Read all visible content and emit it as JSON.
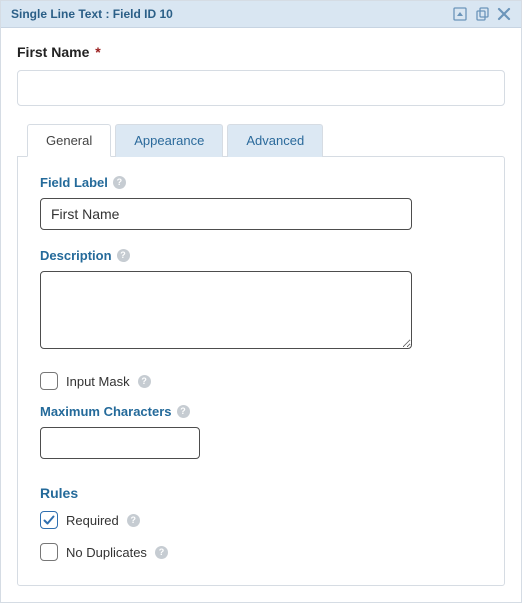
{
  "header": {
    "title": "Single Line Text : Field ID 10"
  },
  "preview": {
    "label": "First Name",
    "required_marker": "*",
    "value": ""
  },
  "tabs": [
    {
      "id": "general",
      "label": "General",
      "active": true
    },
    {
      "id": "appearance",
      "label": "Appearance",
      "active": false
    },
    {
      "id": "advanced",
      "label": "Advanced",
      "active": false
    }
  ],
  "general": {
    "field_label_heading": "Field Label",
    "field_label_value": "First Name",
    "description_heading": "Description",
    "description_value": "",
    "input_mask_label": "Input Mask",
    "input_mask_checked": false,
    "max_chars_heading": "Maximum Characters",
    "max_chars_value": "",
    "rules_heading": "Rules",
    "required_label": "Required",
    "required_checked": true,
    "no_duplicates_label": "No Duplicates",
    "no_duplicates_checked": false
  },
  "colors": {
    "heading": "#246a9a",
    "header_bg": "#d9e6f2",
    "tab_inactive_bg": "#dce8f3",
    "required": "#9a1d1d",
    "check": "#2f6fb0"
  }
}
